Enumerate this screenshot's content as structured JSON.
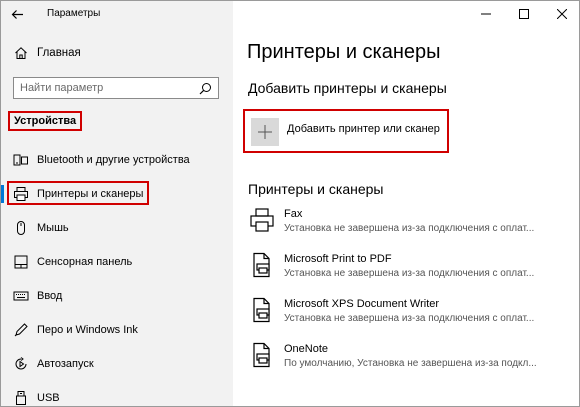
{
  "window": {
    "title": "Параметры"
  },
  "sidebar": {
    "home_label": "Главная",
    "search_placeholder": "Найти параметр",
    "section_title": "Устройства",
    "items": [
      {
        "label": "Bluetooth и другие устройства",
        "icon": "bluetooth-devices-icon"
      },
      {
        "label": "Принтеры и сканеры",
        "icon": "printer-icon",
        "selected": true
      },
      {
        "label": "Мышь",
        "icon": "mouse-icon"
      },
      {
        "label": "Сенсорная панель",
        "icon": "touchpad-icon"
      },
      {
        "label": "Ввод",
        "icon": "keyboard-icon"
      },
      {
        "label": "Перо и Windows Ink",
        "icon": "pen-icon"
      },
      {
        "label": "Автозапуск",
        "icon": "autoplay-icon"
      },
      {
        "label": "USB",
        "icon": "usb-icon"
      }
    ]
  },
  "main": {
    "title": "Принтеры и сканеры",
    "add_section_title": "Добавить принтеры и сканеры",
    "add_button_label": "Добавить принтер или сканер",
    "list_title": "Принтеры и сканеры",
    "printers": [
      {
        "name": "Fax",
        "status": "Установка не завершена из-за подключения с оплат...",
        "icon": "fax-printer-icon"
      },
      {
        "name": "Microsoft Print to PDF",
        "status": "Установка не завершена из-за подключения с оплат...",
        "icon": "printer-doc-icon"
      },
      {
        "name": "Microsoft XPS Document Writer",
        "status": "Установка не завершена из-за подключения с оплат...",
        "icon": "printer-doc-icon"
      },
      {
        "name": "OneNote",
        "status": "По умолчанию, Установка не завершена из-за подкл...",
        "icon": "printer-doc-icon"
      }
    ]
  },
  "colors": {
    "sidebar_bg": "#f2f2f2",
    "accent": "#0078d7",
    "highlight_red": "#d00000",
    "add_tile": "#d9d9d9"
  }
}
